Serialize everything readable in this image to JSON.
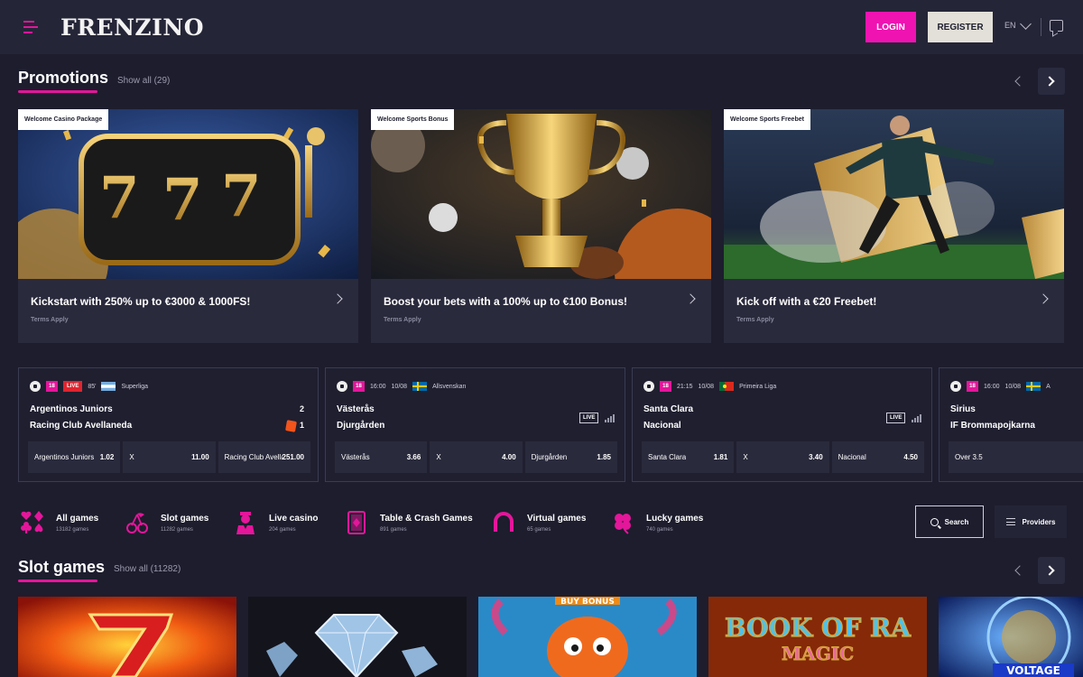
{
  "header": {
    "logo": "FRENZINO",
    "login_label": "LOGIN",
    "register_label": "REGISTER",
    "language": "EN"
  },
  "promotions": {
    "title": "Promotions",
    "show_all": "Show all (29)",
    "cards": [
      {
        "badge": "Welcome Casino Package",
        "title": "Kickstart with 250% up to €3000 & 1000FS!",
        "terms": "Terms Apply"
      },
      {
        "badge": "Welcome Sports Bonus",
        "title": "Boost your bets with a 100% up to €100 Bonus!",
        "terms": "Terms Apply"
      },
      {
        "badge": "Welcome Sports Freebet",
        "title": "Kick off with a €20 Freebet!",
        "terms": "Terms Apply"
      }
    ]
  },
  "matches": [
    {
      "age": "18",
      "live": "LIVE",
      "time": "85'",
      "league": "Superliga",
      "team1": "Argentinos Juniors",
      "team2": "Racing Club Avellaneda",
      "score1": "2",
      "score2": "1",
      "odds": [
        {
          "label": "Argentinos Juniors",
          "value": "1.02"
        },
        {
          "label": "X",
          "value": "11.00"
        },
        {
          "label": "Racing Club Avellaneda",
          "value": "251.00"
        }
      ]
    },
    {
      "age": "18",
      "time": "16:00",
      "date": "10/08",
      "league": "Allsvenskan",
      "team1": "Västerås",
      "team2": "Djurgården",
      "live_tag": "LIVE",
      "odds": [
        {
          "label": "Västerås",
          "value": "3.66"
        },
        {
          "label": "X",
          "value": "4.00"
        },
        {
          "label": "Djurgården",
          "value": "1.85"
        }
      ]
    },
    {
      "age": "18",
      "time": "21:15",
      "date": "10/08",
      "league": "Primeira Liga",
      "team1": "Santa Clara",
      "team2": "Nacional",
      "live_tag": "LIVE",
      "odds": [
        {
          "label": "Santa Clara",
          "value": "1.81"
        },
        {
          "label": "X",
          "value": "3.40"
        },
        {
          "label": "Nacional",
          "value": "4.50"
        }
      ]
    },
    {
      "age": "18",
      "time": "16:00",
      "date": "10/08",
      "league": "A",
      "team1": "Sirius",
      "team2": "IF Brommapojkarna",
      "odds": [
        {
          "label": "Over 3.5",
          "value": ""
        }
      ]
    }
  ],
  "categories": [
    {
      "name": "All games",
      "count": "13182 games",
      "icon": "cards-suits-icon"
    },
    {
      "name": "Slot games",
      "count": "11282 games",
      "icon": "cherry-icon"
    },
    {
      "name": "Live casino",
      "count": "204 games",
      "icon": "dealer-icon"
    },
    {
      "name": "Table & Crash Games",
      "count": "891 games",
      "icon": "playing-card-icon"
    },
    {
      "name": "Virtual games",
      "count": "65 games",
      "icon": "horseshoe-icon"
    },
    {
      "name": "Lucky games",
      "count": "740 games",
      "icon": "clover-icon"
    }
  ],
  "search_label": "Search",
  "providers_label": "Providers",
  "slots": {
    "title": "Slot games",
    "show_all": "Show all (11282)",
    "tiles": [
      {
        "name": "hot-seven-slot"
      },
      {
        "name": "diamonds-slot"
      },
      {
        "name": "octopus-slot",
        "text": "BUY BONUS"
      },
      {
        "name": "book-of-ra-slot",
        "text": "BOOK OF RA",
        "sub": "MAGIC"
      },
      {
        "name": "voltage-slot",
        "text": "VOLTAGE"
      }
    ]
  },
  "colors": {
    "accent": "#e4169a",
    "login": "#ef13b2",
    "background": "#1d1d2e",
    "header": "#252538",
    "live": "#e0242f"
  }
}
